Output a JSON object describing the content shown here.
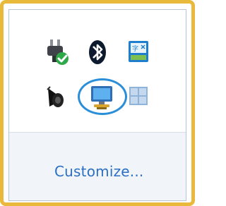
{
  "tray": {
    "icons": [
      {
        "name": "power-plug-icon",
        "interactable": true
      },
      {
        "name": "bluetooth-icon",
        "interactable": true
      },
      {
        "name": "input-language-icon",
        "interactable": true
      },
      {
        "name": "speaker-icon",
        "interactable": true
      },
      {
        "name": "network-icon",
        "interactable": true,
        "highlighted": true
      },
      {
        "name": "windows-flag-icon",
        "interactable": true
      }
    ],
    "highlight_color": "#2a8fd8"
  },
  "footer": {
    "customize_label": "Customize..."
  },
  "colors": {
    "frame_border": "#e8b93a",
    "link": "#2b6fc3",
    "footer_bg": "#f1f5fa"
  }
}
